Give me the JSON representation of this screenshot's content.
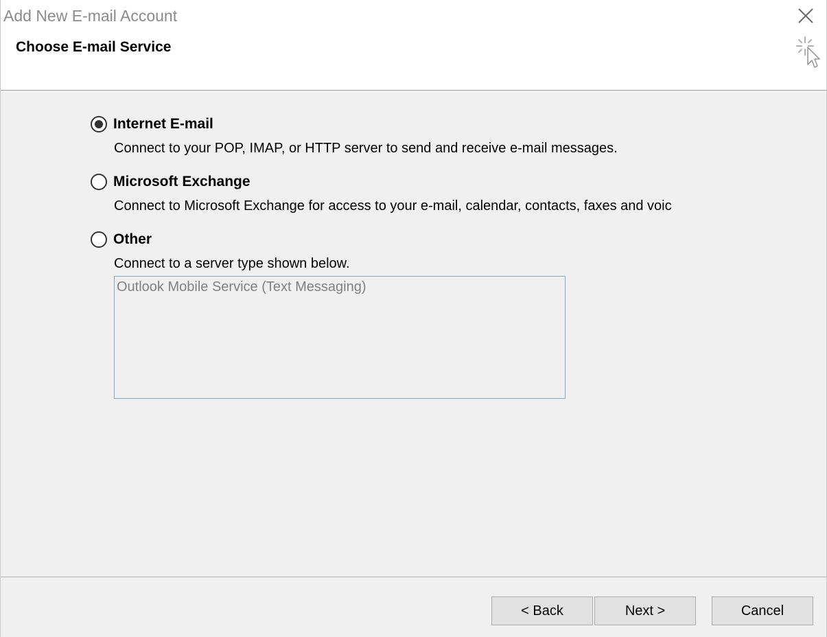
{
  "window": {
    "title": "Add New E-mail Account"
  },
  "header": {
    "section_title": "Choose E-mail Service"
  },
  "options": [
    {
      "label": "Internet E-mail",
      "description": "Connect to your POP, IMAP, or HTTP server to send and receive e-mail messages.",
      "selected": true
    },
    {
      "label": "Microsoft Exchange",
      "description": "Connect to Microsoft Exchange for access to your e-mail, calendar, contacts, faxes and voic",
      "selected": false
    },
    {
      "label": "Other",
      "description": "Connect to a server type shown below.",
      "selected": false
    }
  ],
  "server_list": {
    "items": [
      "Outlook Mobile Service (Text Messaging)"
    ]
  },
  "buttons": {
    "back": "< Back",
    "next": "Next >",
    "cancel": "Cancel"
  },
  "icons": {
    "close": "close-icon",
    "wizard": "wizard-cursor-icon"
  }
}
